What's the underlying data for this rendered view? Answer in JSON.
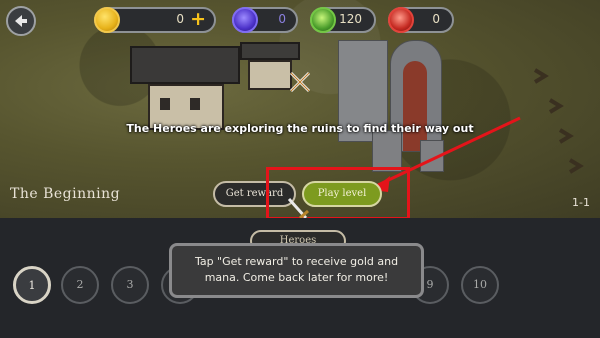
{
  "resources": {
    "gold": "0",
    "gold_add": "+",
    "gems": "0",
    "green_potions": "120",
    "red_potions": "0"
  },
  "scene": {
    "caption": "The Heroes are exploring the ruins to find their way out",
    "chapter_title": "The Beginning",
    "level_id": "1-1"
  },
  "buttons": {
    "get_reward": "Get reward",
    "play_level": "Play level",
    "heroes_tab": "Heroes"
  },
  "tooltip": {
    "line1": "Tap \"Get reward\" to receive gold and",
    "line2": "mana. Come back later for more!"
  },
  "level_selector": {
    "levels": [
      "1",
      "2",
      "3",
      "9",
      "10"
    ],
    "active": "1"
  },
  "colors": {
    "highlight": "#e4141a",
    "play_button": "#7d9b1f"
  },
  "icons": [
    "back-icon",
    "gold-coin-icon",
    "gem-icon",
    "green-potion-icon",
    "red-potion-icon",
    "crossed-swords-icon",
    "sword-icon"
  ]
}
